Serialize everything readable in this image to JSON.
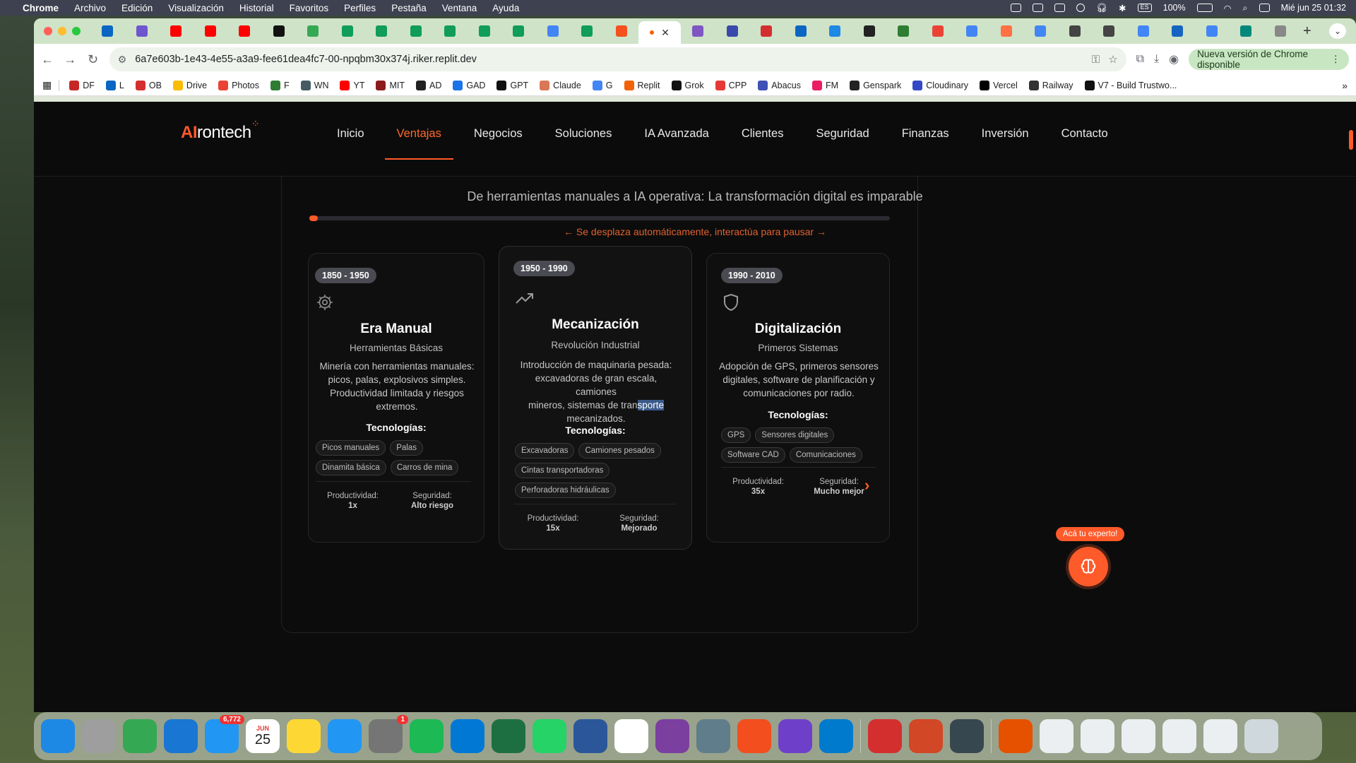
{
  "menubar": {
    "app": "Chrome",
    "items": [
      "Archivo",
      "Edición",
      "Visualización",
      "Historial",
      "Favoritos",
      "Perfiles",
      "Pestaña",
      "Ventana",
      "Ayuda"
    ],
    "lang": "ES",
    "battery": "100%",
    "datetime": "Mié jun 25  01:32"
  },
  "browser": {
    "url": "6a7e603b-1e43-4e55-a3a9-fee61dea4fc7-00-npqbm30x374j.riker.replit.dev",
    "update_label": "Nueva versión de Chrome disponible",
    "tab_colors": [
      "#0a66c2",
      "#6e56cf",
      "#ff0000",
      "#ff0000",
      "#ff0000",
      "#111111",
      "#34a853",
      "#0f9d58",
      "#0f9d58",
      "#0f9d58",
      "#0f9d58",
      "#0f9d58",
      "#0f9d58",
      "#4285f4",
      "#0f9d58",
      "#f4511e"
    ],
    "tab_colors_right": [
      "#7e57c2",
      "#3949ab",
      "#d32f2f",
      "#0a66c2",
      "#1e88e5",
      "#222222",
      "#2e7d32",
      "#ea4335",
      "#4285f4",
      "#ff7043",
      "#4285f4",
      "#444444",
      "#444444",
      "#4285f4",
      "#1565c0",
      "#4285f4",
      "#00897b",
      "#888888"
    ],
    "bookmarks": [
      {
        "label": "DF",
        "color": "#c62828"
      },
      {
        "label": "L",
        "color": "#0a66c2"
      },
      {
        "label": "OB",
        "color": "#d32f2f"
      },
      {
        "label": "Drive",
        "color": "#fbbc04"
      },
      {
        "label": "Photos",
        "color": "#ea4335"
      },
      {
        "label": "F",
        "color": "#2e7d32"
      },
      {
        "label": "WN",
        "color": "#455a64"
      },
      {
        "label": "YT",
        "color": "#ff0000"
      },
      {
        "label": "MIT",
        "color": "#8d1b1b"
      },
      {
        "label": "AD",
        "color": "#222222"
      },
      {
        "label": "GAD",
        "color": "#1a73e8"
      },
      {
        "label": "GPT",
        "color": "#111111"
      },
      {
        "label": "Claude",
        "color": "#d97757"
      },
      {
        "label": "G",
        "color": "#4285f4"
      },
      {
        "label": "Replit",
        "color": "#f26207"
      },
      {
        "label": "Grok",
        "color": "#111111"
      },
      {
        "label": "CPP",
        "color": "#e53935"
      },
      {
        "label": "Abacus",
        "color": "#3f51b5"
      },
      {
        "label": "FM",
        "color": "#e91e63"
      },
      {
        "label": "Genspark",
        "color": "#222222"
      },
      {
        "label": "Cloudinary",
        "color": "#3448c5"
      },
      {
        "label": "Vercel",
        "color": "#000000"
      },
      {
        "label": "Railway",
        "color": "#333333"
      },
      {
        "label": "V7 - Build Trustwo...",
        "color": "#111111"
      }
    ]
  },
  "site": {
    "logo_ai": "AI",
    "logo_rest": "rontech",
    "nav": [
      "Inicio",
      "Ventajas",
      "Negocios",
      "Soluciones",
      "IA Avanzada",
      "Clientes",
      "Seguridad",
      "Finanzas",
      "Inversión",
      "Contacto"
    ],
    "active_nav": "Ventajas",
    "subtitle": "De herramientas manuales a IA operativa: La transformación digital es imparable",
    "scroll_hint": "← Se desplaza automáticamente, interactúa para pausar →",
    "progress": 0.015,
    "tech_heading": "Tecnologías:",
    "cards": [
      {
        "period": "1850 - 1950",
        "icon": "gear-icon",
        "title": "Era Manual",
        "subtitle": "Herramientas Básicas",
        "desc_lines": [
          "Minería con herramientas manuales:",
          "picos, palas, explosivos simples.",
          "Productividad limitada y riesgos",
          "extremos."
        ],
        "techs": [
          "Picos manuales",
          "Palas",
          "Dinamita básica",
          "Carros de mina"
        ],
        "productivity_label": "Productividad:",
        "productivity": "1x",
        "safety_label": "Seguridad:",
        "safety": "Alto riesgo"
      },
      {
        "period": "1950 - 1990",
        "icon": "trending-up-icon",
        "title": "Mecanización",
        "subtitle": "Revolución Industrial",
        "desc_lines": [
          "Introducción de maquinaria pesada:",
          "excavadoras de gran escala, camiones",
          "mineros, sistemas de tran",
          "sporte",
          "mecanizados."
        ],
        "techs": [
          "Excavadoras",
          "Camiones pesados",
          "Cintas transportadoras",
          "Perforadoras hidráulicas"
        ],
        "productivity_label": "Productividad:",
        "productivity": "15x",
        "safety_label": "Seguridad:",
        "safety": "Mejorado"
      },
      {
        "period": "1990 - 2010",
        "icon": "shield-icon",
        "title": "Digitalización",
        "subtitle": "Primeros Sistemas",
        "desc_lines": [
          "Adopción de GPS, primeros sensores",
          "digitales, software de planificación y",
          "comunicaciones por radio."
        ],
        "techs": [
          "GPS",
          "Sensores digitales",
          "Software CAD",
          "Comunicaciones"
        ],
        "productivity_label": "Productividad:",
        "productivity": "35x",
        "safety_label": "Seguridad:",
        "safety": "Mucho mejor"
      }
    ],
    "expert_label": "Acá tu experto!"
  },
  "dock": {
    "mail_badge": "6,772",
    "calendar_month": "JUN",
    "calendar_day": "25",
    "settings_badge": "1",
    "apps": [
      {
        "name": "finder",
        "color": "#1e88e5"
      },
      {
        "name": "launchpad",
        "color": "#9e9e9e"
      },
      {
        "name": "chrome",
        "color": "#34a853"
      },
      {
        "name": "safari",
        "color": "#1976d2"
      },
      {
        "name": "mail",
        "color": "#2196f3"
      },
      {
        "name": "calendar",
        "color": "#ffffff"
      },
      {
        "name": "notes",
        "color": "#fdd835"
      },
      {
        "name": "keynote",
        "color": "#2196f3"
      },
      {
        "name": "settings",
        "color": "#757575"
      },
      {
        "name": "spotify",
        "color": "#1db954"
      },
      {
        "name": "outlook",
        "color": "#0078d4"
      },
      {
        "name": "excel",
        "color": "#1d6f42"
      },
      {
        "name": "whatsapp",
        "color": "#25d366"
      },
      {
        "name": "word",
        "color": "#2b579a"
      },
      {
        "name": "calendar-31",
        "color": "#ffffff"
      },
      {
        "name": "screen-recorder",
        "color": "#7b3fa0"
      },
      {
        "name": "script",
        "color": "#607d8b"
      },
      {
        "name": "figma-like",
        "color": "#f24e1e"
      },
      {
        "name": "github",
        "color": "#6e40c9"
      },
      {
        "name": "vscode",
        "color": "#007acc"
      },
      {
        "name": "acrobat",
        "color": "#d32f2f"
      },
      {
        "name": "powerpoint",
        "color": "#d24726"
      },
      {
        "name": "quicktime",
        "color": "#37474f"
      },
      {
        "name": "bhp",
        "color": "#e65100"
      },
      {
        "name": "doc-1",
        "color": "#eceff1"
      },
      {
        "name": "doc-2",
        "color": "#eceff1"
      },
      {
        "name": "doc-3",
        "color": "#eceff1"
      },
      {
        "name": "doc-4",
        "color": "#eceff1"
      },
      {
        "name": "doc-5",
        "color": "#eceff1"
      },
      {
        "name": "trash",
        "color": "#cfd8dc"
      }
    ]
  }
}
